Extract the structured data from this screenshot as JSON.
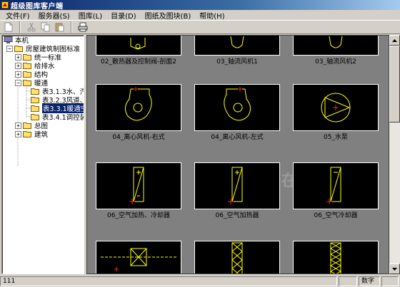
{
  "window": {
    "title": "超级图库客户端",
    "app_icon": "app-icon"
  },
  "menu": [
    "文件(F)",
    "服务器(S)",
    "图库(L)",
    "目录(D)",
    "图纸及图块(B)",
    "帮助(H)"
  ],
  "toolbar": {
    "icons": [
      "new-icon",
      "cut-icon",
      "copy-icon",
      "paste-icon",
      "print-icon"
    ]
  },
  "tree": {
    "root": "本机",
    "library": "房屋建筑制图标准",
    "folders": [
      "统一标准",
      "给排水",
      "结构",
      "暖通"
    ],
    "hvac_children": [
      "表3.1.3水、汽",
      "表3.2.3风道、",
      "表3.3.1暖通空",
      "表3.4.1调控装"
    ],
    "selected_index": 2,
    "more_folders": [
      "总图",
      "建筑"
    ]
  },
  "tiles": [
    {
      "label": "02_散热器及控制阀-剖面2",
      "icon": "radiator-section-icon"
    },
    {
      "label": "03_轴流风机1",
      "icon": "axial-fan-icon"
    },
    {
      "label": "03_轴流风机2",
      "icon": "axial-fan-icon"
    },
    {
      "label": "04_离心风机-右式",
      "icon": "centrifugal-fan-right-icon"
    },
    {
      "label": "04_离心风机-左式",
      "icon": "centrifugal-fan-left-icon"
    },
    {
      "label": "05_水泵",
      "icon": "water-pump-icon"
    },
    {
      "label": "06_空气加热、冷却器",
      "icon": "air-heater-cooler-icon"
    },
    {
      "label": "06_空气加热器",
      "icon": "air-heater-icon"
    },
    {
      "label": "06_空气冷却器",
      "icon": "air-cooler-icon"
    },
    {
      "label": "",
      "icon": "filter-icon"
    },
    {
      "label": "",
      "icon": "filter-icon"
    },
    {
      "label": "",
      "icon": "filter-icon"
    }
  ],
  "status": {
    "count": "111",
    "numlock": "数字"
  },
  "colors": {
    "cad_line": "#ffff00",
    "cad_red": "#ff2020",
    "tile_bg": "#000000",
    "content_bg": "#808080"
  }
}
